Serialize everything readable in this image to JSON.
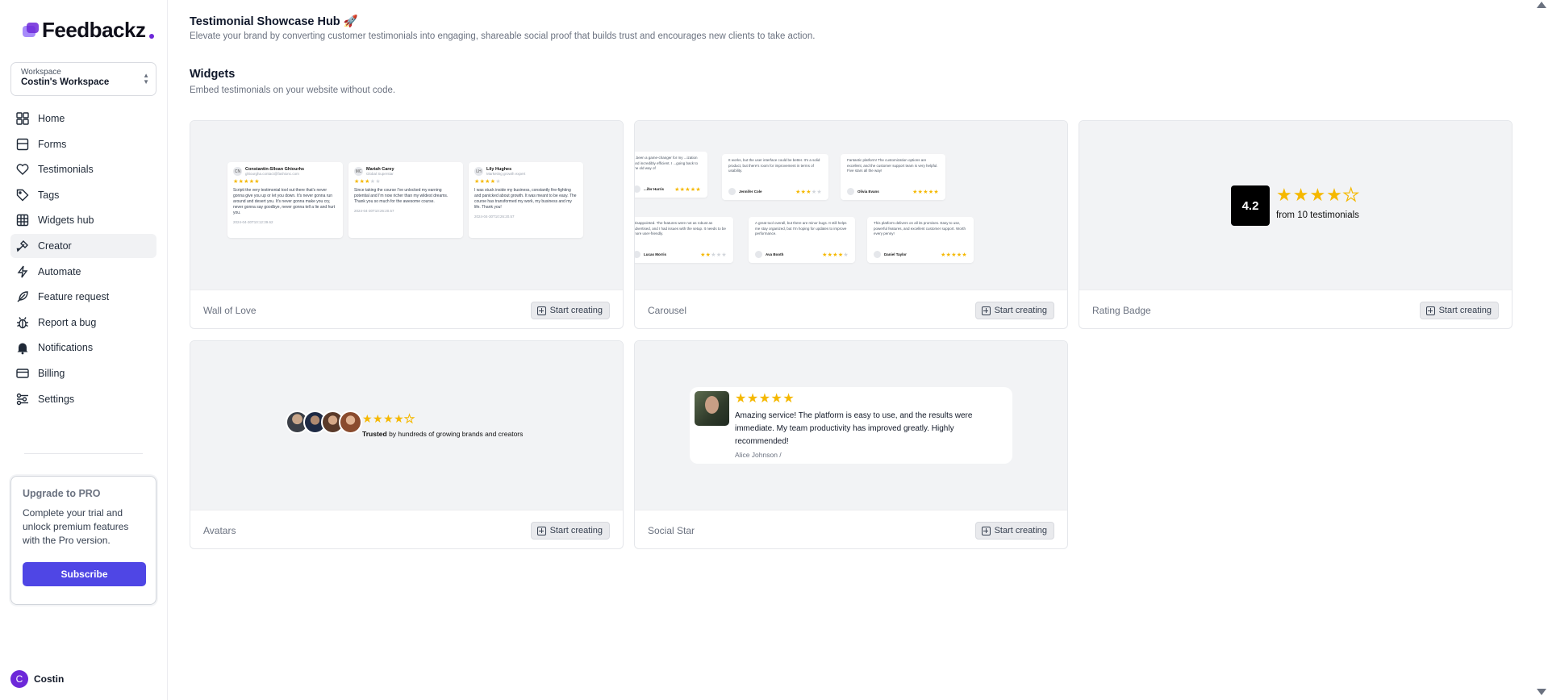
{
  "app": {
    "logo_text": "Feedbackz"
  },
  "workspace": {
    "label": "Workspace",
    "name": "Costin's Workspace"
  },
  "nav": [
    {
      "label": "Home",
      "icon": "home-icon"
    },
    {
      "label": "Forms",
      "icon": "forms-icon"
    },
    {
      "label": "Testimonials",
      "icon": "heart-icon"
    },
    {
      "label": "Tags",
      "icon": "tag-icon"
    },
    {
      "label": "Widgets hub",
      "icon": "grid-icon"
    },
    {
      "label": "Creator",
      "icon": "brush-icon",
      "active": true
    },
    {
      "label": "Automate",
      "icon": "lightning-icon"
    },
    {
      "label": "Feature request",
      "icon": "feather-icon"
    },
    {
      "label": "Report a bug",
      "icon": "bug-icon"
    },
    {
      "label": "Notifications",
      "icon": "bell-icon"
    },
    {
      "label": "Billing",
      "icon": "credit-card-icon"
    },
    {
      "label": "Settings",
      "icon": "sliders-icon"
    }
  ],
  "upgrade": {
    "title": "Upgrade to PRO",
    "text": "Complete your trial and unlock premium features with the Pro version.",
    "button": "Subscribe"
  },
  "user": {
    "initial": "C",
    "name": "Costin"
  },
  "header": {
    "title": "Testimonial Showcase Hub 🚀",
    "subtitle": "Elevate your brand by converting customer testimonials into engaging, shareable social proof that builds trust and encourages new clients to take action."
  },
  "section": {
    "title": "Widgets",
    "subtitle": "Embed testimonials on your website without code."
  },
  "start_label": "Start creating",
  "widgets": {
    "wall": {
      "name": "Wall of Love",
      "items": [
        {
          "initials": "CN",
          "name": "Constantin-Sîloan Ghiourhs",
          "role": "ghiourgha.contact@fashionc.com",
          "stars": 5,
          "text": "Scripti the very testimonial tool out there that's never gonna give you up or let you down. It's never gonna run around and desert you. It's never gonna make you cry, never gonna say goodbye, never gonna tell a lie and hurt you.",
          "date": "2024-04-30T10:12:39.62"
        },
        {
          "initials": "MC",
          "name": "Mariah Carey",
          "role": "Global Superstar",
          "stars": 3,
          "text": "Since taking the course I've unlocked my earning potential and I'm now richer than my wildest dreams. Thank you so much for the awesome course.",
          "date": "2024-04-30T10:26:20.57"
        },
        {
          "initials": "LH",
          "name": "Lily Hughes",
          "role": "Marketing growth expert",
          "stars": 4,
          "text": "I was stuck inside my business, constantly fire-fighting and panicked about growth. It was meant to be easy. The course has transformed my work, my business and my life. Thank you!",
          "date": "2024-04-30T10:26:20.57"
        }
      ]
    },
    "carousel": {
      "name": "Carousel",
      "items": [
        {
          "text": "...been a game-changer for my ...ization and incredibly efficient. I ...going back to the old way of",
          "user": "...ifer Harris",
          "stars": 5
        },
        {
          "text": "It works, but the user interface could be better. It's a solid product, but there's room for improvement in terms of usability.",
          "user": "Jennifer Cole",
          "stars": 3
        },
        {
          "text": "Fantastic platform! The customization options are excellent, and the customer support team is very helpful. Five stars all the way!",
          "user": "Olivia Evans",
          "stars": 5
        },
        {
          "text": "Disappointed. The features were not as robust as advertised, and I had issues with the setup. It needs to be more user-friendly.",
          "user": "Lucas Morris",
          "stars": 2
        },
        {
          "text": "A great tool overall, but there are minor bugs. It still helps me stay organized, but I'm hoping for updates to improve performance.",
          "user": "Ava Booth",
          "stars": 4
        },
        {
          "text": "This platform delivers on all its promises. Easy to use, powerful features, and excellent customer support. Worth every penny!",
          "user": "Daniel Taylor",
          "stars": 5
        }
      ]
    },
    "rating_badge": {
      "name": "Rating Badge",
      "rating": "4.2",
      "stars": 4,
      "text": "from 10 testimonials"
    },
    "avatars": {
      "name": "Avatars",
      "stars": 4,
      "bold": "Trusted",
      "text": " by hundreds of growing brands and creators"
    },
    "social_star": {
      "name": "Social Star",
      "stars": 5,
      "text": "Amazing service! The platform is easy to use, and the results were immediate. My team productivity has improved greatly. Highly recommended!",
      "author": "Alice Johnson /"
    }
  },
  "colors": {
    "accent": "#4f46e5",
    "star": "#f5b800",
    "logo": "#6d28d9"
  }
}
